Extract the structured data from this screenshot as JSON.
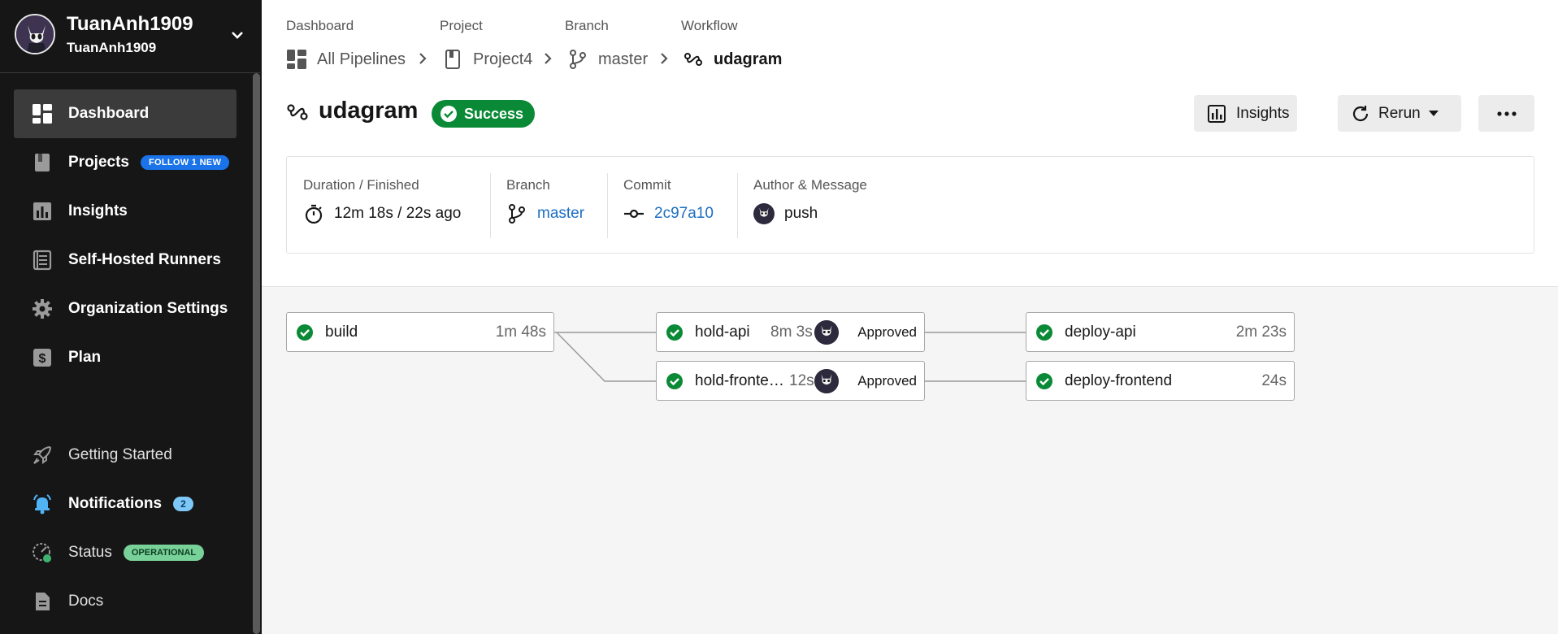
{
  "org": {
    "name": "TuanAnh1909",
    "sub": "TuanAnh1909"
  },
  "sidebar": {
    "items": [
      {
        "label": "Dashboard",
        "icon": "dashboard-icon",
        "active": true
      },
      {
        "label": "Projects",
        "icon": "projects-icon",
        "badge": "FOLLOW 1 NEW"
      },
      {
        "label": "Insights",
        "icon": "insights-icon"
      },
      {
        "label": "Self-Hosted Runners",
        "icon": "runners-icon"
      },
      {
        "label": "Organization Settings",
        "icon": "gear-icon"
      },
      {
        "label": "Plan",
        "icon": "dollar-icon"
      }
    ],
    "bottom": [
      {
        "label": "Getting Started",
        "icon": "rocket-icon"
      },
      {
        "label": "Notifications",
        "icon": "bell-icon",
        "badge": "2"
      },
      {
        "label": "Status",
        "icon": "status-icon",
        "badge": "OPERATIONAL"
      },
      {
        "label": "Docs",
        "icon": "docs-icon"
      }
    ]
  },
  "breadcrumb": {
    "labels": [
      "Dashboard",
      "Project",
      "Branch",
      "Workflow"
    ],
    "items": [
      "All Pipelines",
      "Project4",
      "master",
      "udagram"
    ]
  },
  "workflow": {
    "title": "udagram",
    "status": "Success"
  },
  "actions": {
    "insights": "Insights",
    "rerun": "Rerun"
  },
  "info": {
    "duration_label": "Duration / Finished",
    "duration_value": "12m 18s / 22s ago",
    "branch_label": "Branch",
    "branch_value": "master",
    "commit_label": "Commit",
    "commit_value": "2c97a10",
    "author_label": "Author & Message",
    "author_value": "push"
  },
  "jobs": [
    {
      "name": "build",
      "duration": "1m 48s"
    },
    {
      "name": "hold-api",
      "duration": "8m 3s",
      "approval": "Approved"
    },
    {
      "name": "hold-fronte…",
      "duration": "12s",
      "approval": "Approved"
    },
    {
      "name": "deploy-api",
      "duration": "2m 23s"
    },
    {
      "name": "deploy-frontend",
      "duration": "24s"
    }
  ],
  "colors": {
    "success": "#0a8a36",
    "link": "#1b6fc2",
    "sidebar": "#161616"
  }
}
